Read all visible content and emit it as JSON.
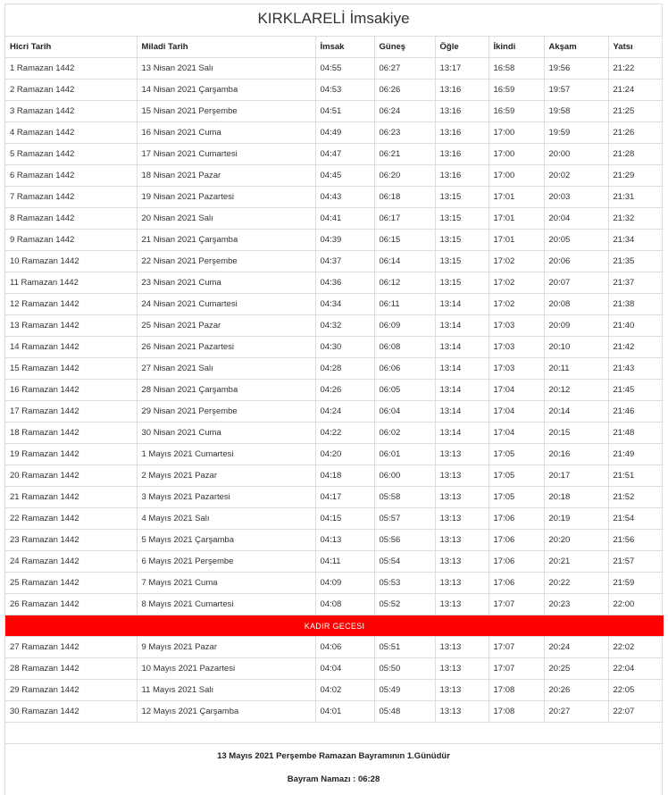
{
  "title": "KIRKLARELİ İmsakiye",
  "columns": [
    "Hicri Tarih",
    "Miladi Tarih",
    "İmsak",
    "Güneş",
    "Öğle",
    "İkindi",
    "Akşam",
    "Yatsı"
  ],
  "rows_before": [
    [
      "1 Ramazan 1442",
      "13 Nisan 2021 Salı",
      "04:55",
      "06:27",
      "13:17",
      "16:58",
      "19:56",
      "21:22"
    ],
    [
      "2 Ramazan 1442",
      "14 Nisan 2021 Çarşamba",
      "04:53",
      "06:26",
      "13:16",
      "16:59",
      "19:57",
      "21:24"
    ],
    [
      "3 Ramazan 1442",
      "15 Nisan 2021 Perşembe",
      "04:51",
      "06:24",
      "13:16",
      "16:59",
      "19:58",
      "21:25"
    ],
    [
      "4 Ramazan 1442",
      "16 Nisan 2021 Cuma",
      "04:49",
      "06:23",
      "13:16",
      "17:00",
      "19:59",
      "21:26"
    ],
    [
      "5 Ramazan 1442",
      "17 Nisan 2021 Cumartesi",
      "04:47",
      "06:21",
      "13:16",
      "17:00",
      "20:00",
      "21:28"
    ],
    [
      "6 Ramazan 1442",
      "18 Nisan 2021 Pazar",
      "04:45",
      "06:20",
      "13:16",
      "17:00",
      "20:02",
      "21:29"
    ],
    [
      "7 Ramazan 1442",
      "19 Nisan 2021 Pazartesi",
      "04:43",
      "06:18",
      "13:15",
      "17:01",
      "20:03",
      "21:31"
    ],
    [
      "8 Ramazan 1442",
      "20 Nisan 2021 Salı",
      "04:41",
      "06:17",
      "13:15",
      "17:01",
      "20:04",
      "21:32"
    ],
    [
      "9 Ramazan 1442",
      "21 Nisan 2021 Çarşamba",
      "04:39",
      "06:15",
      "13:15",
      "17:01",
      "20:05",
      "21:34"
    ],
    [
      "10 Ramazan 1442",
      "22 Nisan 2021 Perşembe",
      "04:37",
      "06:14",
      "13:15",
      "17:02",
      "20:06",
      "21:35"
    ],
    [
      "11 Ramazan 1442",
      "23 Nisan 2021 Cuma",
      "04:36",
      "06:12",
      "13:15",
      "17:02",
      "20:07",
      "21:37"
    ],
    [
      "12 Ramazan 1442",
      "24 Nisan 2021 Cumartesi",
      "04:34",
      "06:11",
      "13:14",
      "17:02",
      "20:08",
      "21:38"
    ],
    [
      "13 Ramazan 1442",
      "25 Nisan 2021 Pazar",
      "04:32",
      "06:09",
      "13:14",
      "17:03",
      "20:09",
      "21:40"
    ],
    [
      "14 Ramazan 1442",
      "26 Nisan 2021 Pazartesi",
      "04:30",
      "06:08",
      "13:14",
      "17:03",
      "20:10",
      "21:42"
    ],
    [
      "15 Ramazan 1442",
      "27 Nisan 2021 Salı",
      "04:28",
      "06:06",
      "13:14",
      "17:03",
      "20:11",
      "21:43"
    ],
    [
      "16 Ramazan 1442",
      "28 Nisan 2021 Çarşamba",
      "04:26",
      "06:05",
      "13:14",
      "17:04",
      "20:12",
      "21:45"
    ],
    [
      "17 Ramazan 1442",
      "29 Nisan 2021 Perşembe",
      "04:24",
      "06:04",
      "13:14",
      "17:04",
      "20:14",
      "21:46"
    ],
    [
      "18 Ramazan 1442",
      "30 Nisan 2021 Cuma",
      "04:22",
      "06:02",
      "13:14",
      "17:04",
      "20:15",
      "21:48"
    ],
    [
      "19 Ramazan 1442",
      "1 Mayıs 2021 Cumartesi",
      "04:20",
      "06:01",
      "13:13",
      "17:05",
      "20:16",
      "21:49"
    ],
    [
      "20 Ramazan 1442",
      "2 Mayıs 2021 Pazar",
      "04:18",
      "06:00",
      "13:13",
      "17:05",
      "20:17",
      "21:51"
    ],
    [
      "21 Ramazan 1442",
      "3 Mayıs 2021 Pazartesi",
      "04:17",
      "05:58",
      "13:13",
      "17:05",
      "20:18",
      "21:52"
    ],
    [
      "22 Ramazan 1442",
      "4 Mayıs 2021 Salı",
      "04:15",
      "05:57",
      "13:13",
      "17:06",
      "20:19",
      "21:54"
    ],
    [
      "23 Ramazan 1442",
      "5 Mayıs 2021 Çarşamba",
      "04:13",
      "05:56",
      "13:13",
      "17:06",
      "20:20",
      "21:56"
    ],
    [
      "24 Ramazan 1442",
      "6 Mayıs 2021 Perşembe",
      "04:11",
      "05:54",
      "13:13",
      "17:06",
      "20:21",
      "21:57"
    ],
    [
      "25 Ramazan 1442",
      "7 Mayıs 2021 Cuma",
      "04:09",
      "05:53",
      "13:13",
      "17:06",
      "20:22",
      "21:59"
    ],
    [
      "26 Ramazan 1442",
      "8 Mayıs 2021 Cumartesi",
      "04:08",
      "05:52",
      "13:13",
      "17:07",
      "20:23",
      "22:00"
    ]
  ],
  "kadir_label": "KADIR GECESI",
  "kadir_color": "#ff0000",
  "rows_after": [
    [
      "27 Ramazan 1442",
      "9 Mayıs 2021 Pazar",
      "04:06",
      "05:51",
      "13:13",
      "17:07",
      "20:24",
      "22:02"
    ],
    [
      "28 Ramazan 1442",
      "10 Mayıs 2021 Pazartesi",
      "04:04",
      "05:50",
      "13:13",
      "17:07",
      "20:25",
      "22:04"
    ],
    [
      "29 Ramazan 1442",
      "11 Mayıs 2021 Salı",
      "04:02",
      "05:49",
      "13:13",
      "17:08",
      "20:26",
      "22:05"
    ],
    [
      "30 Ramazan 1442",
      "12 Mayıs 2021 Çarşamba",
      "04:01",
      "05:48",
      "13:13",
      "17:08",
      "20:27",
      "22:07"
    ]
  ],
  "footer": {
    "bayram_text": "13 Mayıs 2021 Perşembe Ramazan Bayramının 1.Günüdür",
    "namaz_text": "Bayram Namazı : 06:28"
  }
}
